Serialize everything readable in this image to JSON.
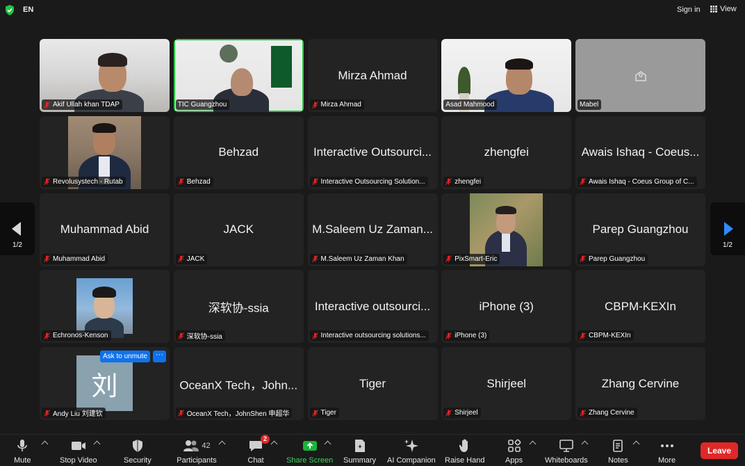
{
  "topbar": {
    "lang": "EN",
    "sign_in": "Sign in",
    "view": "View"
  },
  "participants": [
    {
      "tile_name": "",
      "label": "Akif Ullah khan TDAP",
      "video": true
    },
    {
      "tile_name": "",
      "label": "TIC Guangzhou",
      "video": true,
      "active_speaker": true
    },
    {
      "tile_name": "Mirza Ahmad",
      "label": "Mirza Ahmad",
      "video": false
    },
    {
      "tile_name": "",
      "label": "Asad Mahmood",
      "video": true
    },
    {
      "tile_name": "",
      "label": "Mabel",
      "video": false
    },
    {
      "tile_name": "",
      "label": "Revolusystech - Rutab",
      "video": true
    },
    {
      "tile_name": "Behzad",
      "label": "Behzad",
      "video": false
    },
    {
      "tile_name": "Interactive Outsourci...",
      "label": "Interactive Outsourcing Solution...",
      "video": false
    },
    {
      "tile_name": "zhengfei",
      "label": "zhengfei",
      "video": false
    },
    {
      "tile_name": "Awais Ishaq - Coeus...",
      "label": "Awais Ishaq - Coeus Group of C...",
      "video": false
    },
    {
      "tile_name": "Muhammad Abid",
      "label": "Muhammad Abid",
      "video": false
    },
    {
      "tile_name": "JACK",
      "label": "JACK",
      "video": false
    },
    {
      "tile_name": "M.Saleem Uz Zaman...",
      "label": "M.Saleem Uz Zaman Khan",
      "video": false
    },
    {
      "tile_name": "",
      "label": "PixSmart-Eric",
      "video": true
    },
    {
      "tile_name": "Parep Guangzhou",
      "label": "Parep Guangzhou",
      "video": false
    },
    {
      "tile_name": "",
      "label": "Echronos-Kenson",
      "video": true
    },
    {
      "tile_name": "深软协-ssia",
      "label": "深软协-ssia",
      "video": false
    },
    {
      "tile_name": "Interactive outsourci...",
      "label": "Interactive outsourcing solutions...",
      "video": false
    },
    {
      "tile_name": "iPhone (3)",
      "label": "iPhone (3)",
      "video": false
    },
    {
      "tile_name": "CBPM-KEXIn",
      "label": "CBPM-KEXIn",
      "video": false
    },
    {
      "tile_name": "",
      "label": "Andy Liu 刘建钦",
      "video": false,
      "avatar_char": "刘"
    },
    {
      "tile_name": "OceanX Tech，John...",
      "label": "OceanX Tech，JohnShen 申超华",
      "video": false
    },
    {
      "tile_name": "Tiger",
      "label": "Tiger",
      "video": false
    },
    {
      "tile_name": "Shirjeel",
      "label": "Shirjeel",
      "video": false
    },
    {
      "tile_name": "Zhang Cervine",
      "label": "Zhang Cervine",
      "video": false
    }
  ],
  "hover": {
    "ask_to_unmute": "Ask to unmute",
    "more": "···"
  },
  "pager": {
    "page": "1/2"
  },
  "toolbar": {
    "mute": "Mute",
    "stop_video": "Stop Video",
    "security": "Security",
    "participants": "Participants",
    "participants_count": "42",
    "chat": "Chat",
    "chat_badge": "2",
    "share_screen": "Share Screen",
    "summary": "Summary",
    "ai_companion": "AI Companion",
    "raise_hand": "Raise Hand",
    "apps": "Apps",
    "whiteboards": "Whiteboards",
    "notes": "Notes",
    "more": "More",
    "leave": "Leave"
  },
  "colors": {
    "active_speaker": "#28c840",
    "leave": "#e02828",
    "accent": "#2d8cff",
    "share": "#1bb33a"
  }
}
